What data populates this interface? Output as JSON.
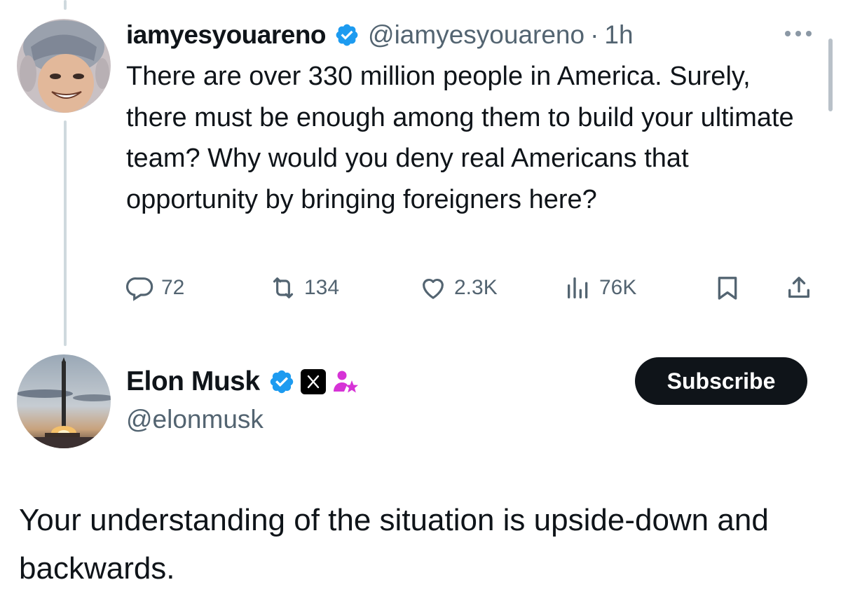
{
  "tweet": {
    "author_name": "iamyesyouareno",
    "author_handle": "@iamyesyouareno",
    "separator": "·",
    "time": "1h",
    "text": "There are over 330 million people in America. Surely, there must be enough among them to build your ultimate team? Why would you deny real Americans that opportunity by bringing foreigners here?",
    "stats": {
      "replies": "72",
      "reposts": "134",
      "likes": "2.3K",
      "views": "76K"
    }
  },
  "reply": {
    "author_name": "Elon Musk",
    "author_handle": "@elonmusk",
    "subscribe_label": "Subscribe",
    "text": "Your understanding of the situation is upside-down and backwards."
  },
  "colors": {
    "verified_blue": "#1d9bf0",
    "text_primary": "#0f1419",
    "text_secondary": "#536471",
    "subscriber_badge": "#d633d6",
    "thread_line": "#cfd9de"
  },
  "icons": {
    "more": "more-horizontal-icon",
    "reply": "reply-bubble-icon",
    "repost": "repost-icon",
    "like": "heart-icon",
    "views": "views-bar-chart-icon",
    "bookmark": "bookmark-icon",
    "share": "share-upload-icon",
    "verified": "verified-badge-icon",
    "x_logo": "x-logo-icon",
    "subscriber": "subscriber-star-icon"
  }
}
